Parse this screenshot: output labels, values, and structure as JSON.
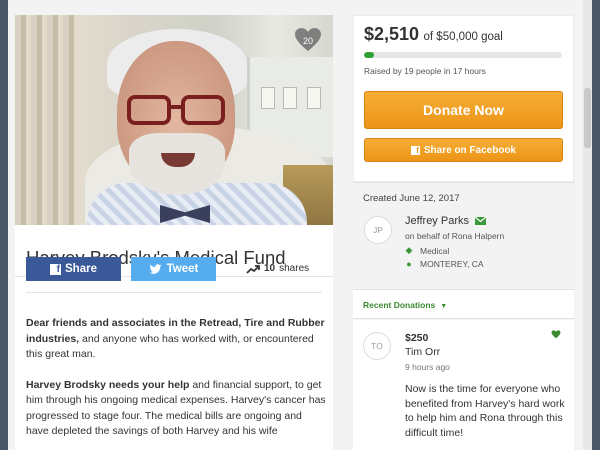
{
  "campaign": {
    "title": "Harvey Brodsky's Medical Fund",
    "photo_alt": "photo of Harvey Brodsky smiling in a hospital bed",
    "likes": "20"
  },
  "share_bar": {
    "facebook_label": "Share",
    "twitter_label": "Tweet",
    "shares_count": "10",
    "shares_suffix": "shares"
  },
  "story": {
    "p1_bold": "Dear friends and associates in the Retread, Tire and Rubber industries,",
    "p1_rest": " and anyone who has worked with, or encountered this great man.",
    "p2_bold": "Harvey Brodsky needs your help",
    "p2_rest": " and financial support, to get him through his ongoing medical expenses. Harvey's cancer has progressed to stage four. The medical bills are ongoing and have depleted the savings of both Harvey and his wife"
  },
  "fundraising": {
    "raised": "$2,510",
    "goal_text": "of $50,000 goal",
    "progress_fraction": 0.05,
    "raised_by": "Raised by 19 people in 17 hours",
    "donate_label": "Donate Now",
    "share_facebook_label": "Share on Facebook"
  },
  "organizer": {
    "created": "Created June 12, 2017",
    "initials": "JP",
    "name": "Jeffrey Parks",
    "on_behalf": "on behalf of Rona Halpern",
    "category": "Medical",
    "location": "MONTEREY, CA"
  },
  "recent_donations": {
    "label": "Recent Donations",
    "items": [
      {
        "initials": "TO",
        "amount": "$250",
        "name": "Tim Orr",
        "time": "9 hours ago",
        "message": "Now is the time for everyone who benefited from Harvey's hard work to help him and Rona through this difficult time!"
      }
    ]
  },
  "colors": {
    "facebook_blue": "#3b5998",
    "twitter_blue": "#55acee",
    "donate_orange": "#ec9417",
    "progress_green": "#2ea032",
    "accent_green": "#3a8a2f"
  }
}
